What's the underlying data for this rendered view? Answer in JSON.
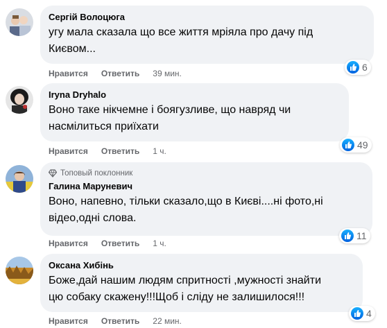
{
  "comments": [
    {
      "author": "Сергій Волоцюга",
      "text": "угу мала сказала що все життя мріяла про дачу під\nКиєвом...",
      "like_label": "Нравится",
      "reply_label": "Ответить",
      "time": "39 мин.",
      "reactions": "6"
    },
    {
      "author": "Iryna Dryhalo",
      "text": "Воно таке нікчемне і боягузливе, що навряд чи\nнасмілиться приїхати",
      "like_label": "Нравится",
      "reply_label": "Ответить",
      "time": "1 ч.",
      "reactions": "49"
    },
    {
      "badge": "Топовый поклонник",
      "author": "Галина Мaруневич",
      "text": "Воно, напевно, тільки сказало,що в Києві....ні фото,ні\nвідео,одні слова.",
      "like_label": "Нравится",
      "reply_label": "Ответить",
      "time": "1 ч.",
      "reactions": "11"
    },
    {
      "author": "Оксана Хибінь",
      "text": "Боже,дай нашим людям спритності ,мужності знайти\nцю собаку скажену!!!Щоб і сліду не залишилося!!!",
      "like_label": "Нравится",
      "reply_label": "Ответить",
      "time": "22 мин.",
      "reactions": "4"
    }
  ],
  "colors": {
    "bubble": "#f0f2f5",
    "meta": "#65676b",
    "like_blue": "#0866ff"
  }
}
